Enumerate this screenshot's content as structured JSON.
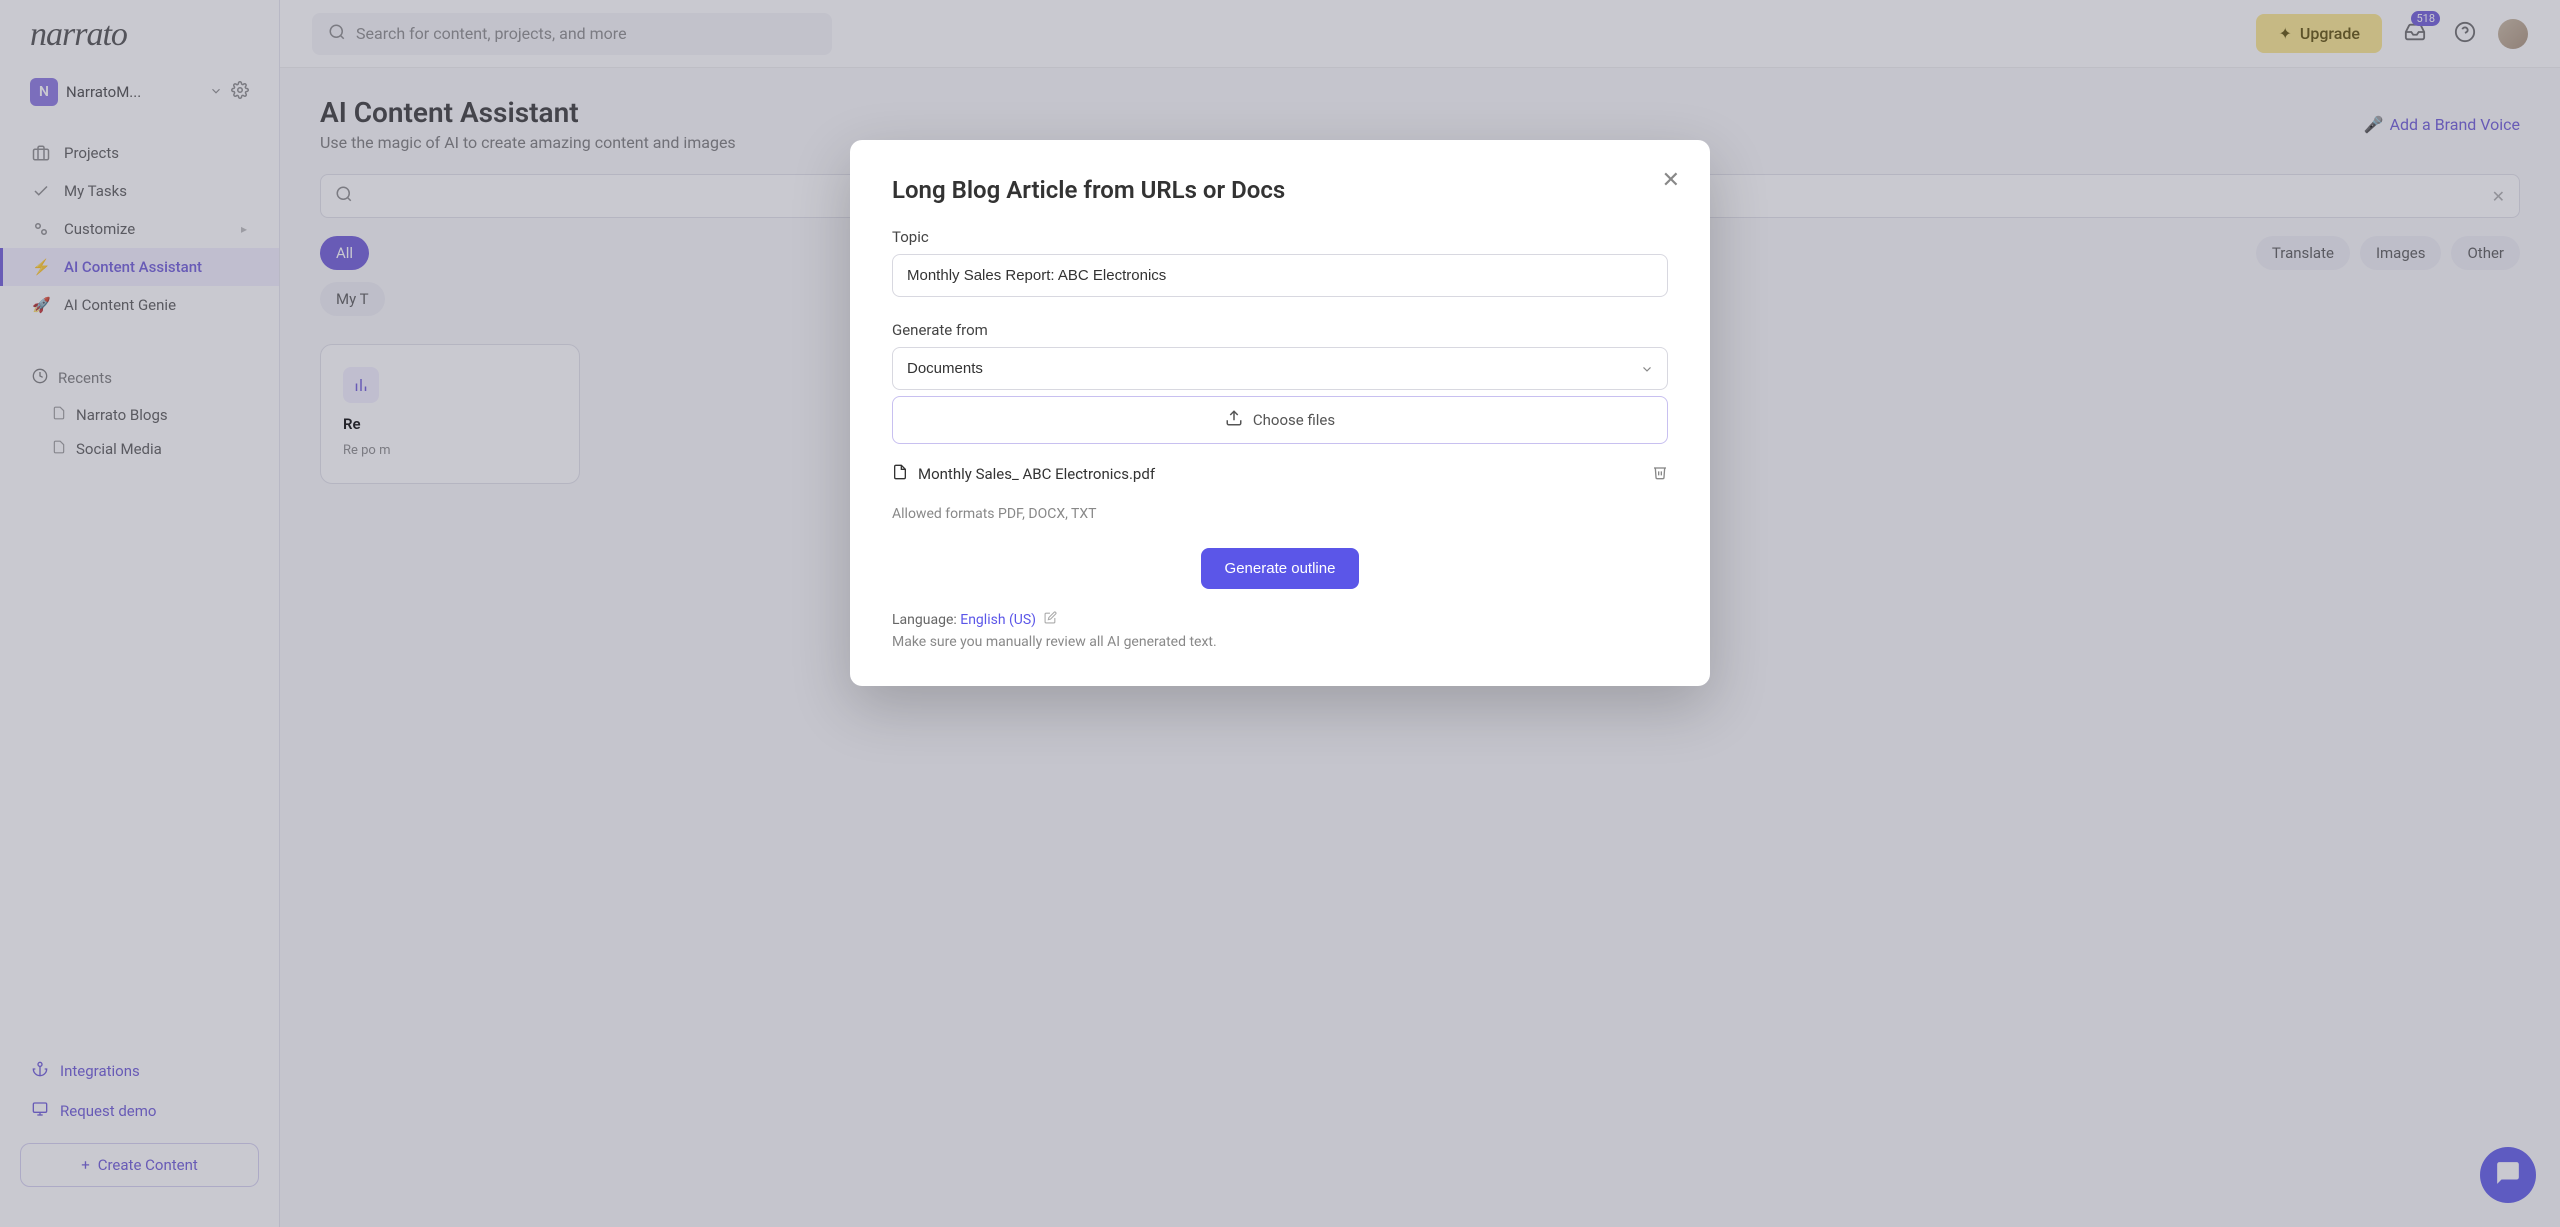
{
  "logo": "narrato",
  "workspace": {
    "badge": "N",
    "name": "NarratoM..."
  },
  "nav": {
    "projects": "Projects",
    "my_tasks": "My Tasks",
    "customize": "Customize",
    "ai_assistant": "AI Content Assistant",
    "ai_genie": "AI Content Genie"
  },
  "recents": {
    "label": "Recents",
    "items": [
      "Narrato Blogs",
      "Social Media"
    ]
  },
  "bottom": {
    "integrations": "Integrations",
    "request_demo": "Request demo",
    "create_content": "Create Content"
  },
  "topbar": {
    "search_placeholder": "Search for content, projects, and more",
    "upgrade": "Upgrade",
    "badge": "518"
  },
  "page": {
    "title": "AI Content Assistant",
    "sub": "Use the magic of AI to create amazing content and images",
    "brand_voice": "Add a Brand Voice"
  },
  "pills": {
    "all": "All",
    "translate": "Translate",
    "images": "Images",
    "other": "Other",
    "my_t": "My T"
  },
  "card": {
    "title": "Re",
    "desc": "Re\npo\nm"
  },
  "modal": {
    "title": "Long Blog Article from URLs or Docs",
    "topic_label": "Topic",
    "topic_value": "Monthly Sales Report: ABC Electronics",
    "gen_from_label": "Generate from",
    "gen_from_value": "Documents",
    "choose_files": "Choose files",
    "file_name": "Monthly Sales_ ABC Electronics.pdf",
    "allowed": "Allowed formats PDF, DOCX, TXT",
    "generate_btn": "Generate outline",
    "lang_label": "Language: ",
    "lang_value": "English (US)",
    "review": "Make sure you manually review all AI generated text."
  }
}
